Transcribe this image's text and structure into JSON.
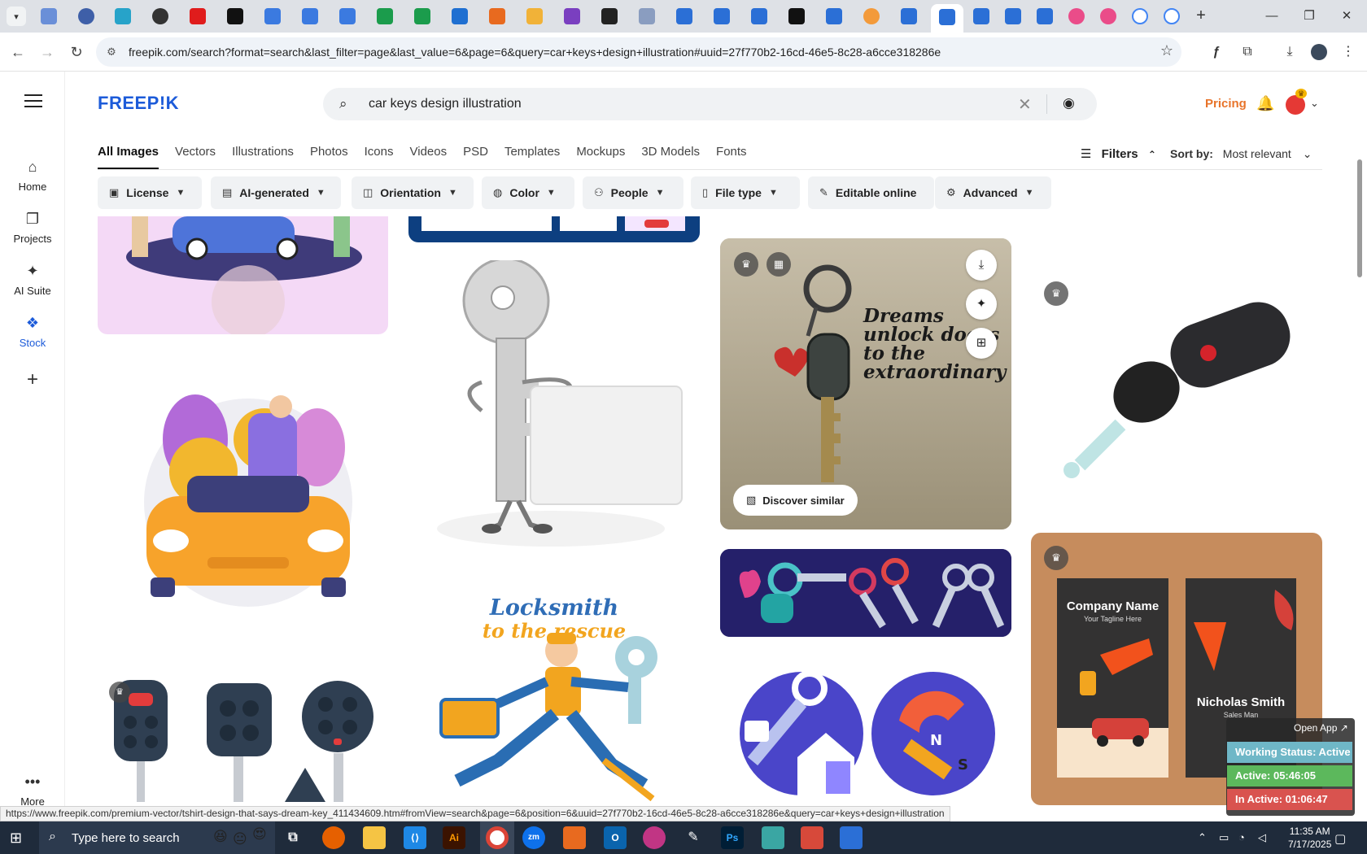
{
  "browser": {
    "url": "freepik.com/search?format=search&last_filter=page&last_value=6&page=6&query=car+keys+design+illustration#uuid=27f770b2-16cd-46e5-8c28-a6cce318286e",
    "newtab_label": "+",
    "status_link": "https://www.freepik.com/premium-vector/tshirt-design-that-says-dream-key_411434609.htm#fromView=search&page=6&position=6&uuid=27f770b2-16cd-46e5-8c28-a6cce318286e&query=car+keys+design+illustration"
  },
  "rail": {
    "items": [
      {
        "label": "Home",
        "icon": "home-icon"
      },
      {
        "label": "Projects",
        "icon": "projects-icon"
      },
      {
        "label": "AI Suite",
        "icon": "sparkle-icon"
      },
      {
        "label": "Stock",
        "icon": "stock-icon"
      },
      {
        "label": "",
        "icon": "plus-icon"
      }
    ],
    "more_label": "More"
  },
  "header": {
    "logo": "FREEP!K",
    "search_value": "car keys design illustration",
    "pricing_label": "Pricing"
  },
  "type_tabs": [
    "All Images",
    "Vectors",
    "Illustrations",
    "Photos",
    "Icons",
    "Videos",
    "PSD",
    "Templates",
    "Mockups",
    "3D Models",
    "Fonts"
  ],
  "filters": {
    "filters_label": "Filters",
    "sort_label": "Sort by:",
    "sort_value": "Most relevant",
    "chips": [
      "License",
      "AI-generated",
      "Orientation",
      "Color",
      "People",
      "File type",
      "Editable online",
      "Advanced"
    ]
  },
  "grid": {
    "dream_poster_text": "Dreams unlock doors to the extraordinary",
    "discover_label": "Discover similar",
    "locksmith_line1": "Locksmith",
    "locksmith_line2": "to the rescue",
    "company_name": "Company Name",
    "tagline": "Your Tagline Here",
    "person_name": "Nicholas Smith",
    "person_title": "Sales Man"
  },
  "tracker": {
    "open_app": "Open App ↗",
    "working_status": "Working Status: Active",
    "active": "Active: 05:46:05",
    "inactive": "In Active: 01:06:47"
  },
  "taskbar": {
    "search_placeholder": "Type here to search",
    "time": "11:35 AM",
    "date": "7/17/2025"
  },
  "colors": {
    "brand": "#1c5bd9",
    "pricing": "#e8742a",
    "status_active": "#5cb85c",
    "status_inactive": "#d9534f",
    "status_working": "#6fb7c7"
  }
}
